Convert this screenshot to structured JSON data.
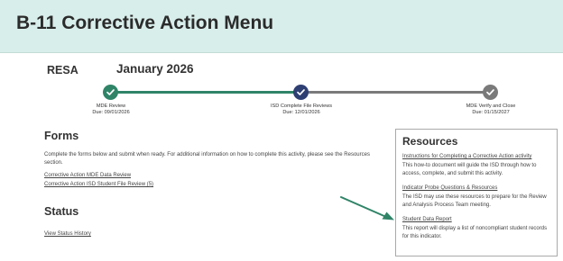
{
  "banner": {
    "title": "B-11 Corrective Action Menu"
  },
  "header": {
    "organization": "RESA",
    "period": "January 2026"
  },
  "colors": {
    "complete": "#2f8468",
    "current": "#2e3f73",
    "upcoming": "#7a7a7a",
    "banner_bg": "#d8eeea"
  },
  "progress": {
    "steps": [
      {
        "name": "MDE Review",
        "due": "Due: 09/01/2026",
        "state": "complete",
        "icon": "check-icon"
      },
      {
        "name": "ISD Complete File Reviews",
        "due": "Due: 12/01/2026",
        "state": "current",
        "icon": "check-icon"
      },
      {
        "name": "MDE Verify and Close",
        "due": "Due: 01/15/2027",
        "state": "upcoming",
        "icon": "check-icon"
      }
    ]
  },
  "forms": {
    "heading": "Forms",
    "intro": "Complete the forms below and submit when ready. For additional information on how to complete this activity, please see the Resources section.",
    "links": [
      "Corrective Action MDE Data Review",
      "Corrective Action ISD Student File Review (5)"
    ]
  },
  "status": {
    "heading": "Status",
    "link": "View Status History"
  },
  "resources": {
    "heading": "Resources",
    "items": [
      {
        "title": "Instructions for Completing a Corrective Action activity",
        "description": "This how-to document will guide the ISD through how to access, complete, and submit this activity."
      },
      {
        "title": "Indicator Probe Questions & Resources",
        "description": "The ISD may use these resources to prepare for the Review and Analysis Process Team meeting."
      },
      {
        "title": "Student Data Report",
        "description": "This report will display a list of noncompliant student records for this indicator."
      }
    ]
  }
}
